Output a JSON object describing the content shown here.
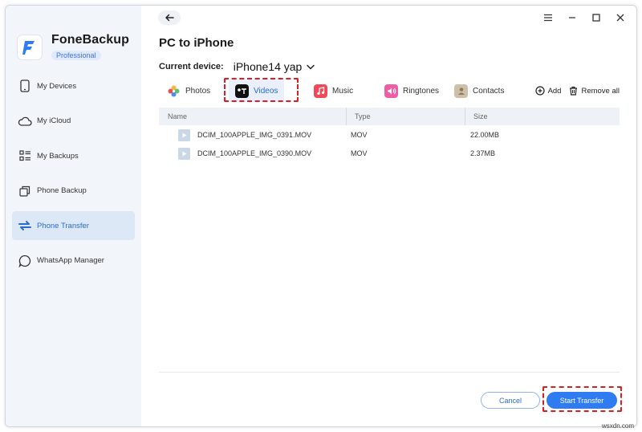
{
  "app": {
    "name": "FoneBackup",
    "edition": "Professional"
  },
  "sidebar": {
    "items": [
      {
        "label": "My Devices",
        "icon": "phone-icon"
      },
      {
        "label": "My iCloud",
        "icon": "cloud-icon"
      },
      {
        "label": "My Backups",
        "icon": "list-icon"
      },
      {
        "label": "Phone Backup",
        "icon": "copy-icon"
      },
      {
        "label": "Phone Transfer",
        "icon": "transfer-arrows-icon",
        "active": true
      },
      {
        "label": "WhatsApp Manager",
        "icon": "chat-bubble-icon"
      }
    ]
  },
  "main": {
    "title": "PC to iPhone",
    "device_label": "Current device:",
    "device_name": "iPhone14 yap",
    "tabs": [
      {
        "label": "Photos",
        "icon": "photos-icon"
      },
      {
        "label": "Videos",
        "icon": "apple-tv-icon",
        "active": true
      },
      {
        "label": "Music",
        "icon": "music-icon"
      },
      {
        "label": "Ringtones",
        "icon": "speaker-icon"
      },
      {
        "label": "Contacts",
        "icon": "contacts-icon"
      }
    ],
    "add_label": "Add",
    "remove_all_label": "Remove all",
    "table": {
      "columns": [
        "Name",
        "Type",
        "Size"
      ],
      "rows": [
        {
          "name": "DCIM_100APPLE_IMG_0391.MOV",
          "type": "MOV",
          "size": "22.00MB"
        },
        {
          "name": "DCIM_100APPLE_IMG_0390.MOV",
          "type": "MOV",
          "size": "2.37MB"
        }
      ]
    },
    "cancel_label": "Cancel",
    "start_label": "Start Transfer"
  },
  "watermark": "wsxdn.com",
  "colors": {
    "accent": "#2f7bf2",
    "highlight": "#d81f26",
    "sidebar_bg": "#f2f6fa",
    "active_bg": "#dde8f6"
  }
}
